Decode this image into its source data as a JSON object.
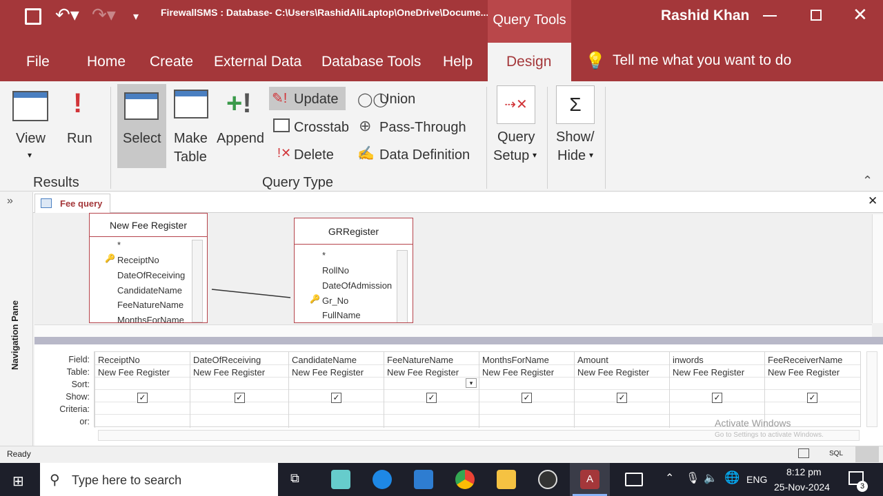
{
  "window": {
    "title": "FirewallSMS : Database- C:\\Users\\RashidAliLaptop\\OneDrive\\Docume...",
    "context_label": "Query Tools",
    "user": "Rashid Khan"
  },
  "tabs": [
    "File",
    "Home",
    "Create",
    "External Data",
    "Database Tools",
    "Help",
    "Design"
  ],
  "tell_me": "Tell me what you want to do",
  "ribbon": {
    "view": "View",
    "run": "Run",
    "results_group": "Results",
    "select": "Select",
    "make_table_1": "Make",
    "make_table_2": "Table",
    "append": "Append",
    "update": "Update",
    "crosstab": "Crosstab",
    "delete": "Delete",
    "union": "Union",
    "pass_through": "Pass-Through",
    "data_definition": "Data Definition",
    "query_type_group": "Query Type",
    "query_setup_1": "Query",
    "query_setup_2": "Setup",
    "show_hide_1": "Show/",
    "show_hide_2": "Hide"
  },
  "doc_tab": "Fee query",
  "nav_pane": "Navigation Pane",
  "table1": {
    "name": "New Fee Register",
    "fields": [
      "*",
      "ReceiptNo",
      "DateOfReceiving",
      "CandidateName",
      "FeeNatureName",
      "MonthsForName"
    ]
  },
  "table2": {
    "name": "GRRegister",
    "fields": [
      "*",
      "RollNo",
      "DateOfAdmission",
      "Gr_No",
      "FullName"
    ]
  },
  "grid": {
    "row_labels": [
      "Field:",
      "Table:",
      "Sort:",
      "Show:",
      "Criteria:",
      "or:"
    ],
    "columns": [
      {
        "field": "ReceiptNo",
        "table": "New Fee Register"
      },
      {
        "field": "DateOfReceiving",
        "table": "New Fee Register"
      },
      {
        "field": "CandidateName",
        "table": "New Fee Register"
      },
      {
        "field": "FeeNatureName",
        "table": "New Fee Register"
      },
      {
        "field": "MonthsForName",
        "table": "New Fee Register"
      },
      {
        "field": "Amount",
        "table": "New Fee Register"
      },
      {
        "field": "inwords",
        "table": "New Fee Register"
      },
      {
        "field": "FeeReceiverName",
        "table": "New Fee Register"
      }
    ]
  },
  "watermark": {
    "line1": "Activate Windows",
    "line2": "Go to Settings to activate Windows."
  },
  "status": {
    "text": "Ready",
    "sql": "SQL"
  },
  "taskbar": {
    "search": "Type here to search",
    "lang": "ENG",
    "time": "8:12 pm",
    "date": "25-Nov-2024",
    "notifications": "3"
  },
  "colors": {
    "accent": "#a4373a",
    "taskbar": "#1d1f2a"
  }
}
